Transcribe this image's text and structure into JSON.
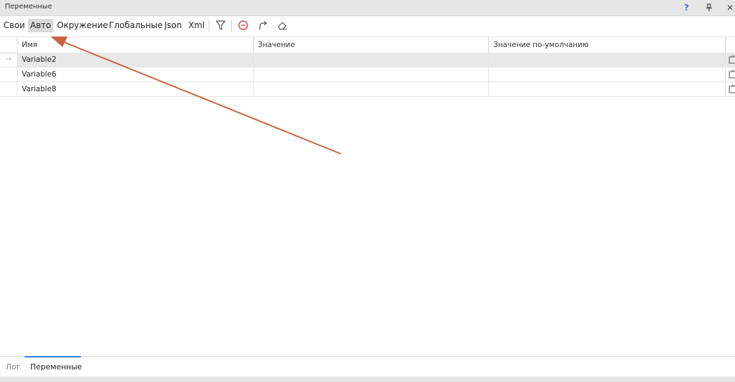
{
  "window": {
    "title": "Переменные",
    "help": "?",
    "pin": "🖈",
    "close": "✕"
  },
  "toolbar": {
    "tabs": [
      {
        "label": "Свои",
        "active": false
      },
      {
        "label": "Авто",
        "active": true
      },
      {
        "label": "Окружение",
        "active": false
      },
      {
        "label": "Глобальные",
        "active": false
      },
      {
        "label": "Json",
        "active": false
      },
      {
        "label": "Xml",
        "active": false
      }
    ],
    "icons": [
      "filter-icon",
      "remove-icon",
      "redo-icon",
      "eraser-icon"
    ]
  },
  "grid": {
    "columns": [
      "Имя",
      "Значение",
      "Значение по-умолчанию"
    ],
    "rows": [
      {
        "name": "Variable2",
        "value": "",
        "default": "",
        "selected": true
      },
      {
        "name": "Variable6",
        "value": "",
        "default": "",
        "selected": false
      },
      {
        "name": "Variable8",
        "value": "",
        "default": "",
        "selected": false
      }
    ],
    "row_indicator": "→"
  },
  "bottom_tabs": [
    {
      "label": "Лог",
      "active": false
    },
    {
      "label": "Переменные",
      "active": true
    }
  ],
  "colors": {
    "accent": "#2f7de1",
    "annotation_arrow": "#c8623e",
    "remove_icon": "#e03c3c"
  }
}
